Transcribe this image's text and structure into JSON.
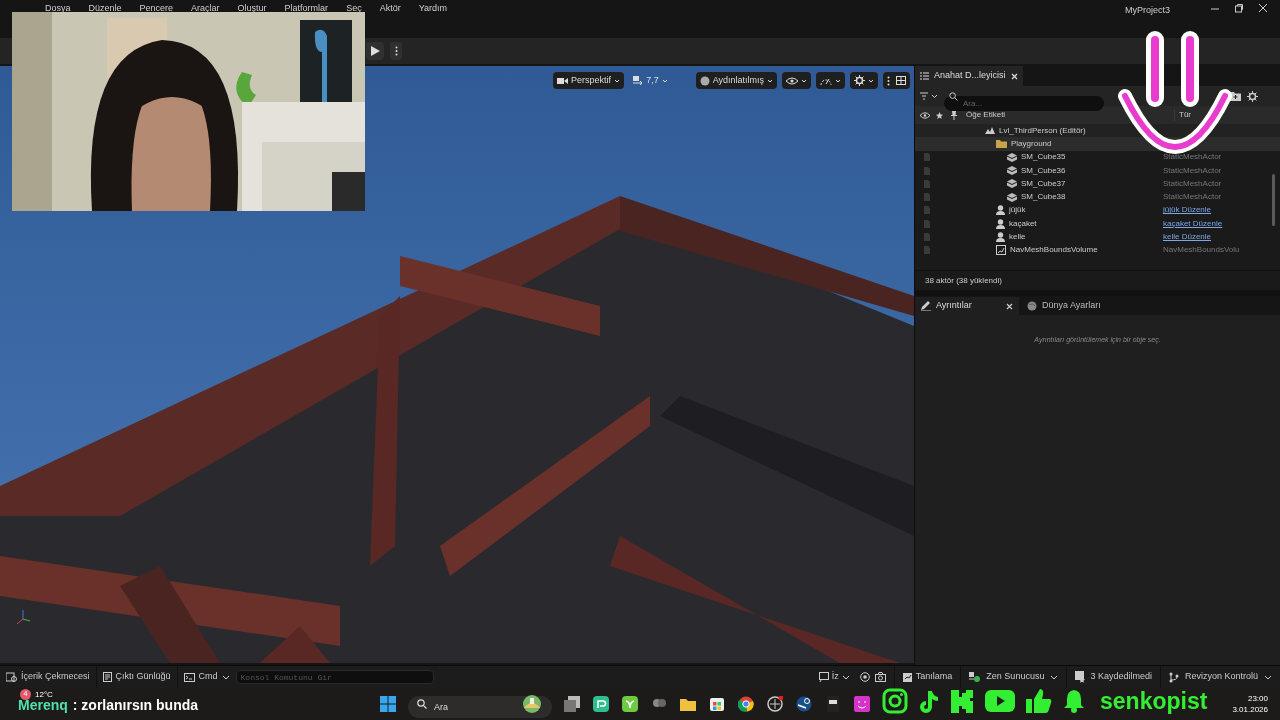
{
  "window": {
    "title": "MyProject3"
  },
  "menu": [
    "Dosya",
    "Düzenle",
    "Pencere",
    "Araçlar",
    "Oluştur",
    "Platformlar",
    "Seç",
    "Aktör",
    "Yardım"
  ],
  "viewport_toolbar": {
    "view_mode": "Perspektif",
    "camera_speed": "7,7",
    "lighting": "Aydınlatılmış"
  },
  "outliner": {
    "tab": "Anahat D...leyicisi",
    "search_placeholder": "Ara...",
    "columns": [
      "Öğe Etiketi",
      "Tür"
    ],
    "rows": [
      {
        "label": "Lvl_ThirdPerson (Editör)",
        "kind": "level",
        "children": [
          {
            "label": "Playground",
            "kind": "folder",
            "children": [
              {
                "label": "SM_Cube35",
                "kind": "mesh",
                "type": "StaticMeshActor",
                "type_link": false
              },
              {
                "label": "SM_Cube36",
                "kind": "mesh",
                "type": "StaticMeshActor",
                "type_link": false
              },
              {
                "label": "SM_Cube37",
                "kind": "mesh",
                "type": "StaticMeshActor",
                "type_link": false
              },
              {
                "label": "SM_Cube38",
                "kind": "mesh",
                "type": "StaticMeshActor",
                "type_link": false
              }
            ]
          },
          {
            "label": "jüjük",
            "kind": "character",
            "type": "jüjük Düzenle",
            "type_link": true
          },
          {
            "label": "kaçaket",
            "kind": "character",
            "type": "kaçaket Düzenle",
            "type_link": true
          },
          {
            "label": "kelle",
            "kind": "character",
            "type": "kelle Düzenle",
            "type_link": true
          },
          {
            "label": "NavMeshBoundsVolume",
            "kind": "volume",
            "type": "NavMeshBoundsVolu",
            "type_link": false
          }
        ]
      }
    ],
    "status": "38 aktör (38 yüklendi)"
  },
  "details": {
    "tabs": [
      {
        "label": "Ayrıntılar",
        "selected": true
      },
      {
        "label": "Dünya Ayarları",
        "selected": false
      }
    ],
    "empty_message": "Ayrıntıları görüntülemek için bir obje seç."
  },
  "status_bar": {
    "left": [
      "İçerik Çekmecesi",
      "Çıktı Günlüğü"
    ],
    "cmd": "Cmd",
    "console_placeholder": "Konsol Komutunu Gir",
    "trace": "İz",
    "right": [
      "Tanılama",
      "Zen Sunucusu",
      "3 Kaydedilmedi",
      "Revizyon Kontrolü"
    ]
  },
  "taskbar": {
    "weather": "12°C",
    "notification_count": "4",
    "search_placeholder": "Ara",
    "time": "23:00",
    "date": "3.01.2026"
  },
  "chat": {
    "user": "Merenq",
    "message": ": zorlanırsın bunda"
  },
  "stream_name": "senkopist"
}
